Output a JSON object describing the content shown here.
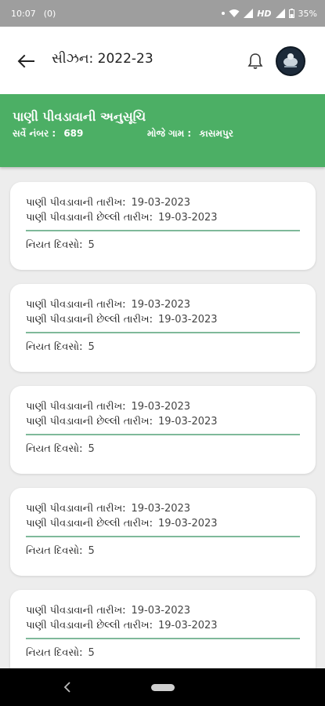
{
  "status_bar": {
    "time": "10:07",
    "notification": "(0)",
    "network": "HD",
    "battery": "35%"
  },
  "app_bar": {
    "title": "સીઝન: 2022-23",
    "back_icon": "arrow-left-icon",
    "bell_icon": "bell-icon",
    "avatar_icon": "profile-logo"
  },
  "banner": {
    "title": "પાણી પીવડાવાની અનુસૂચિ",
    "survey_label": "સર્વે નંબર :",
    "survey_value": "689",
    "village_label": "મોજે ગામ :",
    "village_value": "કાસમપુર"
  },
  "cards": [
    {
      "start_label": "પાણી પીવડાવાની તારીખ:",
      "start_value": "19-03-2023",
      "end_label": "પાણી પીવડાવાની છેલ્લી તારીખ:",
      "end_value": "19-03-2023",
      "days_label": "નિયત દિવસો:",
      "days_value": "5"
    },
    {
      "start_label": "પાણી પીવડાવાની તારીખ:",
      "start_value": "19-03-2023",
      "end_label": "પાણી પીવડાવાની છેલ્લી તારીખ:",
      "end_value": "19-03-2023",
      "days_label": "નિયત દિવસો:",
      "days_value": "5"
    },
    {
      "start_label": "પાણી પીવડાવાની તારીખ:",
      "start_value": "19-03-2023",
      "end_label": "પાણી પીવડાવાની છેલ્લી તારીખ:",
      "end_value": "19-03-2023",
      "days_label": "નિયત દિવસો:",
      "days_value": "5"
    },
    {
      "start_label": "પાણી પીવડાવાની તારીખ:",
      "start_value": "19-03-2023",
      "end_label": "પાણી પીવડાવાની છેલ્લી તારીખ:",
      "end_value": "19-03-2023",
      "days_label": "નિયત દિવસો:",
      "days_value": "5"
    },
    {
      "start_label": "પાણી પીવડાવાની તારીખ:",
      "start_value": "19-03-2023",
      "end_label": "પાણી પીવડાવાની છેલ્લી તારીખ:",
      "end_value": "19-03-2023",
      "days_label": "નિયત દિવસો:",
      "days_value": "5"
    }
  ],
  "colors": {
    "banner": "#4caf65",
    "divider": "#7fb99a",
    "background": "#ededed",
    "status_bar": "#9e9e9e"
  },
  "nav_bar": {
    "back_icon": "nav-back-icon",
    "home_icon": "nav-home-pill"
  }
}
